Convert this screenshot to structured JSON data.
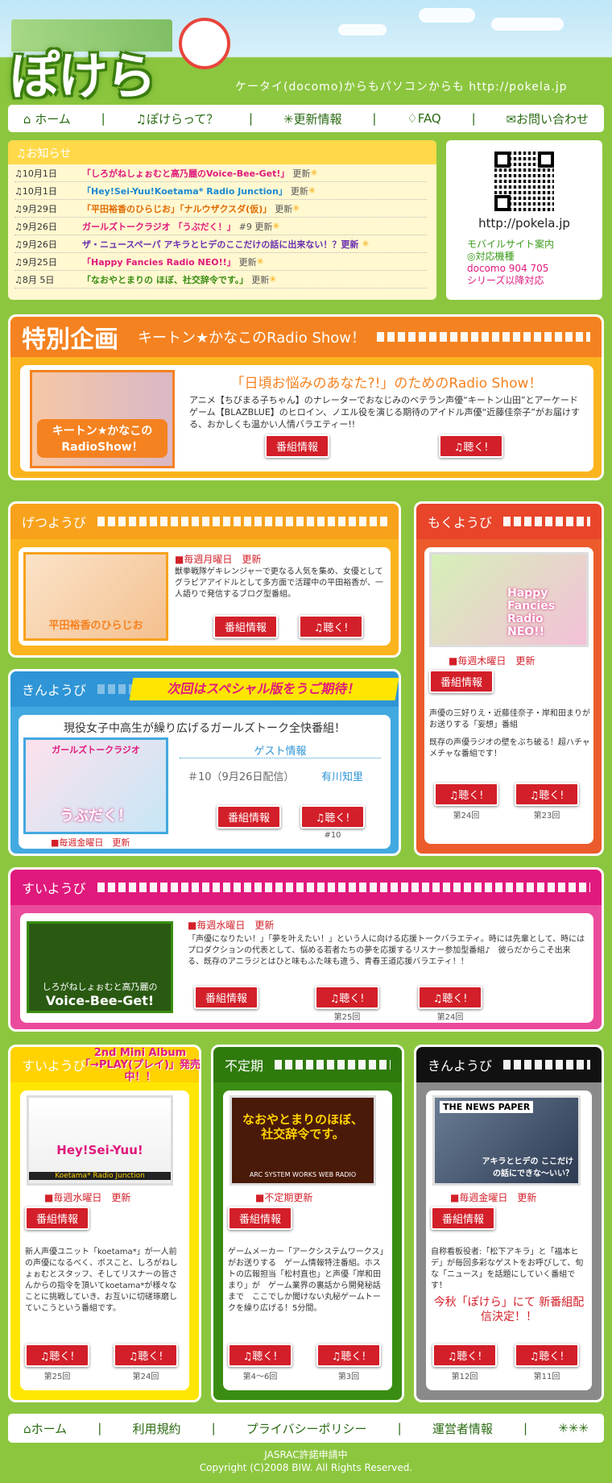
{
  "header": {
    "logo": "ぽけら",
    "tagline": "ケータイ(docomo)からもパソコンからも http://pokela.jp"
  },
  "nav": {
    "items": [
      "ホーム",
      "ぽけらって？",
      "更新情報",
      "FAQ",
      "お問い合わせ"
    ]
  },
  "news": {
    "title": "お知らせ",
    "items": [
      {
        "date": "10月1日",
        "text": "「しろがねしょぉむと高乃麗のVoice-Bee-Get!」",
        "suffix": "更新",
        "color": "#e0197d"
      },
      {
        "date": "10月1日",
        "text": "「Hey!Sei-Yuu!Koetama* Radio Junction」",
        "suffix": "更新",
        "color": "#1a8ad4"
      },
      {
        "date": "9月29日",
        "text": "「平田裕香のひらじお」「ナルウザクスダ(仮)」",
        "suffix": "更新",
        "color": "#e06a00"
      },
      {
        "date": "9月26日",
        "text": "ガールズトークラジオ 「うぶだく！」",
        "suffix": "#9 更新",
        "color": "#e0197d"
      },
      {
        "date": "9月26日",
        "text": "ザ・ニュースペーパ アキラとヒデのここだけの話に出来ない！？更新",
        "suffix": "",
        "color": "#6a2fb0"
      },
      {
        "date": "9月25日",
        "text": "「Happy Fancies Radio NEO!!」",
        "suffix": "更新",
        "color": "#e0197d"
      },
      {
        "date": "8月 5日",
        "text": "「なおやとまりの ほぼ、社交辞令です。」",
        "suffix": "更新",
        "color": "#3a8d12"
      }
    ]
  },
  "mobile": {
    "url": "http://pokela.jp",
    "lines": [
      "モバイルサイト案内",
      "◎対応機種",
      "docomo 904 705",
      "シリーズ以降対応"
    ]
  },
  "special": {
    "label": "特別企画",
    "title": "キートン★かなこのRadio Show！",
    "thumb_text": "キートン★かなこの RadioShow！",
    "headline": "「日頃お悩みのあなた?!」のためのRadio Show！",
    "desc": "アニメ【ちびまる子ちゃん】のナレーターでおなじみのベテラン声優“キートン山田”とアーケードゲーム【BLAZBLUE】のヒロイン、ノエル役を演じる期待のアイドル声優“近藤佳奈子”がお届けする、おかしくも温かい人情バラエティー!!",
    "btn_info": "番組情報",
    "btn_listen": "♫聴く!"
  },
  "monday": {
    "day": "げつようび",
    "thumb_text": "平田裕香のひらじお",
    "update": "■毎週月曜日　更新",
    "desc": "獣拳戦隊ゲキレンジャーで更なる人気を集め、女優としてグラビアアイドルとして多方面で活躍中の平田裕香が、一人語りで発信するブログ型番組。",
    "btn_info": "番組情報",
    "btn_listen": "♫聴く!"
  },
  "thursday": {
    "day": "もくようび",
    "thumb_text": "Happy Fancies Radio NEO!!",
    "update": "■毎週木曜日　更新",
    "desc1": "声優の三好りえ・近藤佳奈子・岸和田まりがお送りする「妄想」番組",
    "desc2": "既存の声優ラジオの壁をぶち破る！超ハチャメチャな番組です！",
    "btn_info": "番組情報",
    "btn_listen": "♫聴く!",
    "cap1": "第24回",
    "cap2": "第23回"
  },
  "friday1": {
    "day": "きんようび",
    "banner": "次回はスペシャル版をうご期待！",
    "title": "現役女子中高生が繰り広げるガールズトーク全快番組！",
    "thumb_text1": "ガールズトークラジオ",
    "thumb_text2": "うぶだく！",
    "guest_label": "ゲスト情報",
    "guest_ep": "＃10（9月26日配信）",
    "guest_name": "有川知里",
    "update": "■毎週金曜日　更新",
    "btn_info": "番組情報",
    "btn_listen": "♫聴く!",
    "cap": "#10"
  },
  "wednesday": {
    "day": "すいようび",
    "thumb_text1": "しろがねしょぉむと高乃麗の",
    "thumb_text2": "Voice-Bee-Get!",
    "update": "■毎週水曜日　更新",
    "desc": "「声優になりたい！」「夢を叶えたい！」という人に向ける応援トークバラエティ。時には先輩として、時にはプロダクションの代表として、悩める若者たちの夢を応援するリスナー参加型番組♪　彼らだからこそ出来る、既存のアニラジとはひと味もふた味も違う、青春王道応援バラエティ！！",
    "btn_info": "番組情報",
    "btn_listen": "♫聴く!",
    "cap1": "第25回",
    "cap2": "第24回"
  },
  "wed2": {
    "day": "すいようび",
    "album": "2nd Mini Album「→PLAY(プレイ)」発売中！！",
    "thumb_text": "Hey!Sei-Yuu!",
    "thumb_sub": "Koetama* Radio Junction",
    "update": "■毎週水曜日　更新",
    "desc": "新人声優ユニット「koetama*」が一人前の声優になるべく、ボスこと、しろがねしょぉむとスタッフ、そしてリスナーの皆さんからの指令を頂いてkoetama*が様々なことに挑戦していき、お互いに切磋琢磨していこうという番組です。",
    "btn_info": "番組情報",
    "btn_listen": "♫聴く!",
    "cap1": "第25回",
    "cap2": "第24回"
  },
  "irregular": {
    "day": "不定期",
    "thumb_text": "なおやとまりのほぼ、社交辞令です。",
    "thumb_sub": "ARC SYSTEM WORKS WEB RADIO",
    "update": "■不定期更新",
    "desc": "ゲームメーカー「アークシステムワークス」がお送りする　ゲーム情報特注番組。ホストの広報担当「松村直也」と声優「岸和田まり」が　ゲーム業界の裏話から開発秘話まで　ここでしか聞けない丸秘ゲームトークを繰り広げる！5分間。",
    "btn_info": "番組情報",
    "btn_listen": "♫聴く!",
    "cap1": "第4〜6回",
    "cap2": "第3回"
  },
  "friday2": {
    "day": "きんようび",
    "thumb_text1": "THE NEWS PAPER",
    "thumb_text2": "アキラとヒデの ここだけの話にできな〜いい？",
    "update": "■毎週金曜日　更新",
    "desc": "自称看板役者:「松下アキラ」と「福本ヒデ」が毎回多彩なゲストをお呼びして、旬な「ニュース」を話題にしていく番組です！",
    "notice": "今秋「ぽけら」にて 新番組配信決定！！",
    "btn_info": "番組情報",
    "btn_listen": "♫聴く!",
    "cap1": "第12回",
    "cap2": "第11回"
  },
  "footer": {
    "links": [
      "ホーム",
      "利用規約",
      "プライバシーポリシー",
      "運営者情報"
    ],
    "jasrac": "JASRAC許諾申請中",
    "copyright": "Copyright (C)2008 BIW. All Rights Reserved."
  }
}
